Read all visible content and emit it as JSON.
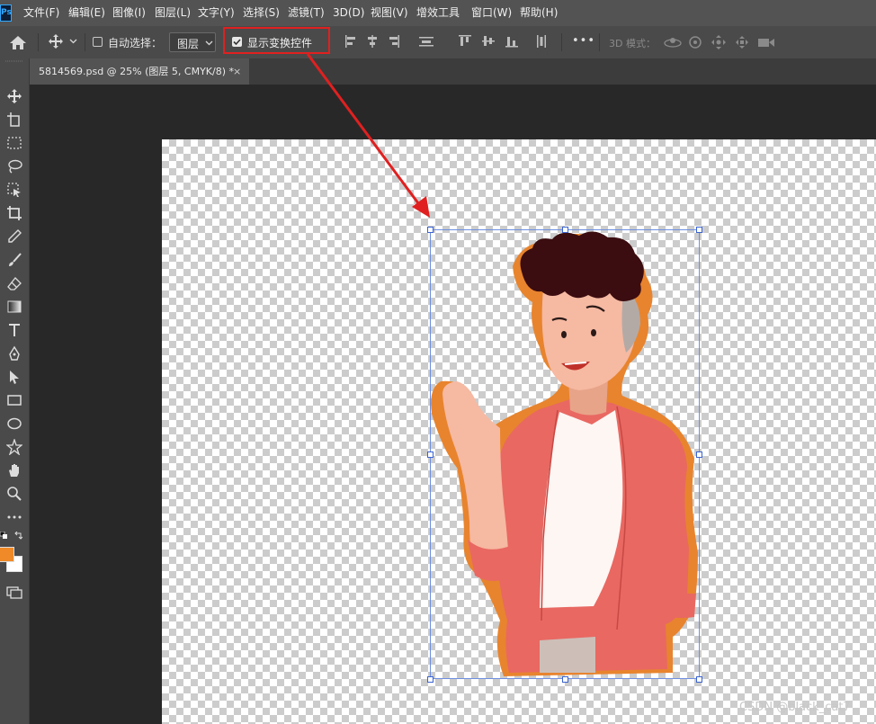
{
  "app": {
    "logo": "Ps"
  },
  "menu": [
    "文件(F)",
    "编辑(E)",
    "图像(I)",
    "图层(L)",
    "文字(Y)",
    "选择(S)",
    "滤镜(T)",
    "3D(D)",
    "视图(V)",
    "增效工具",
    "窗口(W)",
    "帮助(H)"
  ],
  "options": {
    "auto_select_label": "自动选择：",
    "auto_select_checked": false,
    "layer_select": "图层",
    "show_transform_label": "显示变换控件",
    "show_transform_checked": true,
    "more": "•••",
    "mode3d_label": "3D 模式："
  },
  "document": {
    "tab_title": "5814569.psd @ 25% (图层 5, CMYK/8) *",
    "close": "×"
  },
  "tools": [
    "move-tool",
    "artboard-tool",
    "marquee-tool",
    "lasso-tool",
    "object-select-tool",
    "crop-tool",
    "eyedropper-tool",
    "brush-tool",
    "eraser-tool",
    "gradient-tool",
    "type-tool",
    "pen-tool",
    "path-select-tool",
    "rectangle-tool",
    "ellipse-tool",
    "custom-shape-tool",
    "hand-tool",
    "zoom-tool",
    "more-tools"
  ],
  "colors": {
    "foreground": "#f08a28",
    "background": "#ffffff",
    "accent": "#e02020"
  },
  "watermark": "CSDN @black_cat7"
}
